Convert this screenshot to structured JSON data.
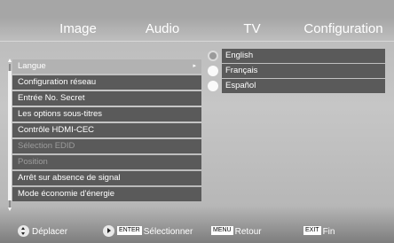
{
  "tabs": [
    {
      "label": "Image"
    },
    {
      "label": "Audio"
    },
    {
      "label": "TV"
    },
    {
      "label": "Configuration"
    }
  ],
  "menu": {
    "items": [
      {
        "label": "Langue",
        "selected": true,
        "disabled": false,
        "has_submenu": true,
        "arrow": "▸"
      },
      {
        "label": "Configuration réseau",
        "selected": false,
        "disabled": false
      },
      {
        "label": "Entrée No. Secret",
        "selected": false,
        "disabled": false
      },
      {
        "label": "Les options sous-titres",
        "selected": false,
        "disabled": false
      },
      {
        "label": "Contrôle HDMI-CEC",
        "selected": false,
        "disabled": false
      },
      {
        "label": "Sélection EDID",
        "selected": false,
        "disabled": true
      },
      {
        "label": "Position",
        "selected": false,
        "disabled": true
      },
      {
        "label": "Arrêt sur absence de signal",
        "selected": false,
        "disabled": false
      },
      {
        "label": "Mode économie d'énergie",
        "selected": false,
        "disabled": false
      }
    ]
  },
  "language_options": [
    {
      "label": "English",
      "checked": true
    },
    {
      "label": "Français",
      "checked": false
    },
    {
      "label": "Español",
      "checked": false
    }
  ],
  "footer": {
    "move": {
      "label": "Déplacer"
    },
    "select": {
      "key": "ENTER",
      "label": "Sélectionner"
    },
    "back": {
      "key": "MENU",
      "label": "Retour"
    },
    "exit": {
      "key": "EXIT",
      "label": "Fin"
    }
  },
  "colors": {
    "item_bg": "#5a5a5a",
    "item_selected_bg": "#b2b2b2",
    "text": "#ffffff",
    "disabled_text": "#9c9c9c"
  }
}
